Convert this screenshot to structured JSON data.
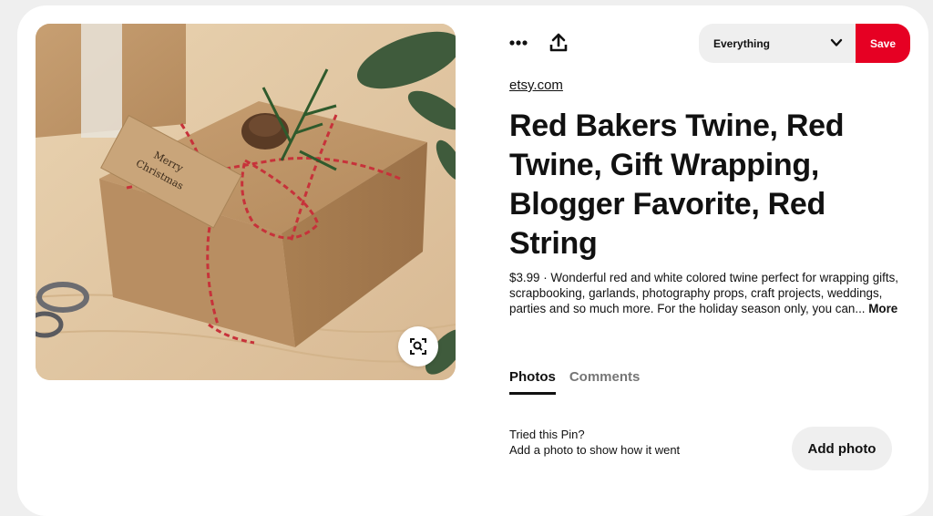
{
  "toolbar": {
    "more_icon": "ellipsis-icon",
    "share_icon": "share-upload-icon",
    "board_select_value": "Everything",
    "board_select_icon": "chevron-down-icon",
    "save_label": "Save"
  },
  "pin": {
    "image_description_icon": "visual-search-icon",
    "tag_text_line1": "Merry",
    "tag_text_line2": "Christmas",
    "source": "etsy.com",
    "title": "Red Bakers Twine, Red Twine, Gift Wrapping, Blogger Favorite, Red String",
    "description": "$3.99 · Wonderful red and white colored twine perfect for wrapping gifts, scrapbooking, garlands, photography props, craft projects, weddings, parties and so much more. For the holiday season only, you can...",
    "more_label": "More"
  },
  "tabs": [
    {
      "label": "Photos",
      "active": true
    },
    {
      "label": "Comments",
      "active": false
    }
  ],
  "tried": {
    "title": "Tried this Pin?",
    "subtitle": "Add a photo to show how it went",
    "button_label": "Add photo"
  },
  "colors": {
    "save_red": "#e60023",
    "pill_gray": "#efefef",
    "text": "#111111",
    "muted": "#767676"
  }
}
